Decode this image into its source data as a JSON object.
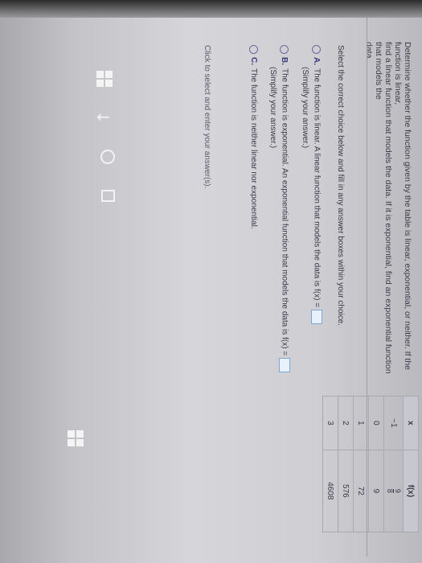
{
  "question": {
    "lines": [
      "Determine whether the function given by the table is linear, exponential, or neither. If the function is linear,",
      "find a linear function that models the data. If it is exponential, find an exponential function that models the",
      "data."
    ]
  },
  "table": {
    "headers": [
      "x",
      "f(x)"
    ],
    "rows": [
      {
        "x": "−1",
        "fx_num": "9",
        "fx_den": "8"
      },
      {
        "x": "0",
        "fx": "9"
      },
      {
        "x": "1",
        "fx": "72"
      },
      {
        "x": "2",
        "fx": "576"
      },
      {
        "x": "3",
        "fx": "4608"
      }
    ]
  },
  "instruction": "Select the correct choice below and fill in any answer boxes within your choice.",
  "choices": [
    {
      "letter": "A.",
      "text": "The function is linear. A linear function that models the data is f(x) =",
      "hint": "(Simplify your answer.)"
    },
    {
      "letter": "B.",
      "text": "The function is exponential. An exponential function that models the data is f(x) =",
      "hint": "(Simplify your answer.)"
    },
    {
      "letter": "C.",
      "text": "The function is neither linear nor exponential."
    }
  ],
  "footer_prompt": "Click to select and enter your answer(s).",
  "taskbar": {
    "icons": [
      "windows-icon",
      "back-arrow-icon",
      "circle-icon",
      "task-view-icon",
      "windows-icon"
    ]
  }
}
